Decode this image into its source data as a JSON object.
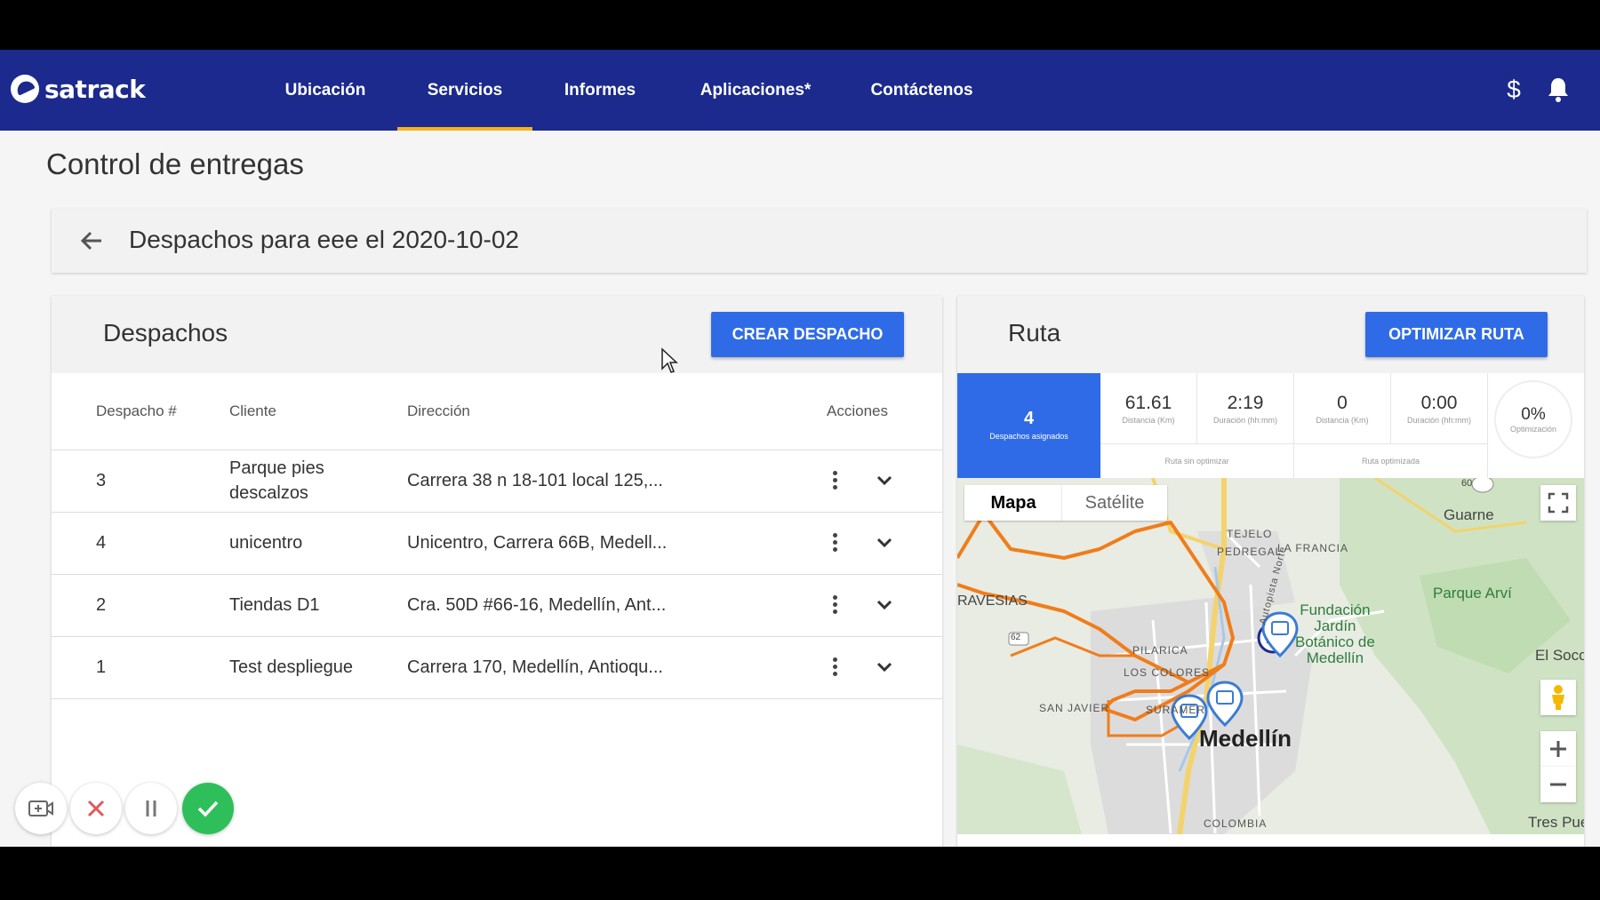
{
  "app": {
    "brand": "satrack"
  },
  "nav": {
    "items": [
      {
        "label": "Ubicación"
      },
      {
        "label": "Servicios"
      },
      {
        "label": "Informes"
      },
      {
        "label": "Aplicaciones*"
      },
      {
        "label": "Contáctenos"
      }
    ],
    "active": "Servicios",
    "icons": [
      "dollar-icon",
      "bell-icon"
    ],
    "dollar_glyph": "$"
  },
  "page": {
    "title": "Control de entregas",
    "subtitle": "Despachos para eee el 2020-10-02"
  },
  "despachos": {
    "title": "Despachos",
    "create_label": "CREAR DESPACHO",
    "columns": [
      "Despacho #",
      "Cliente",
      "Dirección",
      "Acciones"
    ],
    "rows": [
      {
        "num": "3",
        "cliente": "Parque pies descalzos",
        "direccion": "Carrera 38 n 18-101 local 125,..."
      },
      {
        "num": "4",
        "cliente": "unicentro",
        "direccion": "Unicentro, Carrera 66B, Medell..."
      },
      {
        "num": "2",
        "cliente": "Tiendas D1",
        "direccion": "Cra. 50D #66-16, Medellín, Ant..."
      },
      {
        "num": "1",
        "cliente": "Test despliegue",
        "direccion": "Carrera 170, Medellín, Antioqu..."
      }
    ]
  },
  "ruta": {
    "title": "Ruta",
    "optimize_label": "OPTIMIZAR RUTA",
    "assigned": {
      "value": "4",
      "label": "Despachos asignados"
    },
    "sin_optimizar": {
      "label": "Ruta sin optimizar",
      "distancia": "61.61",
      "distancia_label": "Distancia (Km)",
      "duracion": "2:19",
      "duracion_label": "Duración (hh:mm)"
    },
    "optimizada": {
      "label": "Ruta optimizada",
      "distancia": "0",
      "distancia_label": "Distancia (Km)",
      "duracion": "0:00",
      "duracion_label": "Duración (hh:mm)"
    },
    "optimizacion": {
      "value": "0%",
      "label": "Optimización"
    }
  },
  "map": {
    "tabs": [
      "Mapa",
      "Satélite"
    ],
    "active_tab": "Mapa",
    "labels": {
      "guarne": "Guarne",
      "tejelo": "TEJELO",
      "pedregal": "PEDREGAL",
      "la_francia": "LA FRANCIA",
      "autopista": "Autopista Norte",
      "travesias": "RAVESIAS",
      "parque_arvi": "Parque Arví",
      "jardin": "Fundación\nJardín\nBotánico de\nMedellín",
      "el_socorro": "El Socor",
      "pilarica": "PILARICA",
      "los_colores": "LOS COLORES",
      "san_javier": "SAN JAVIER",
      "suramericana": "SURAMER",
      "medellin": "Medellín",
      "colombia": "COLOMBIA",
      "tres_puertas": "Tres Puer",
      "road_60": "60",
      "road_62": "62"
    },
    "route_color": "#f07d1a"
  },
  "recorder": {
    "controls": [
      "camera-icon",
      "close-icon",
      "pause-icon",
      "check-icon"
    ]
  }
}
